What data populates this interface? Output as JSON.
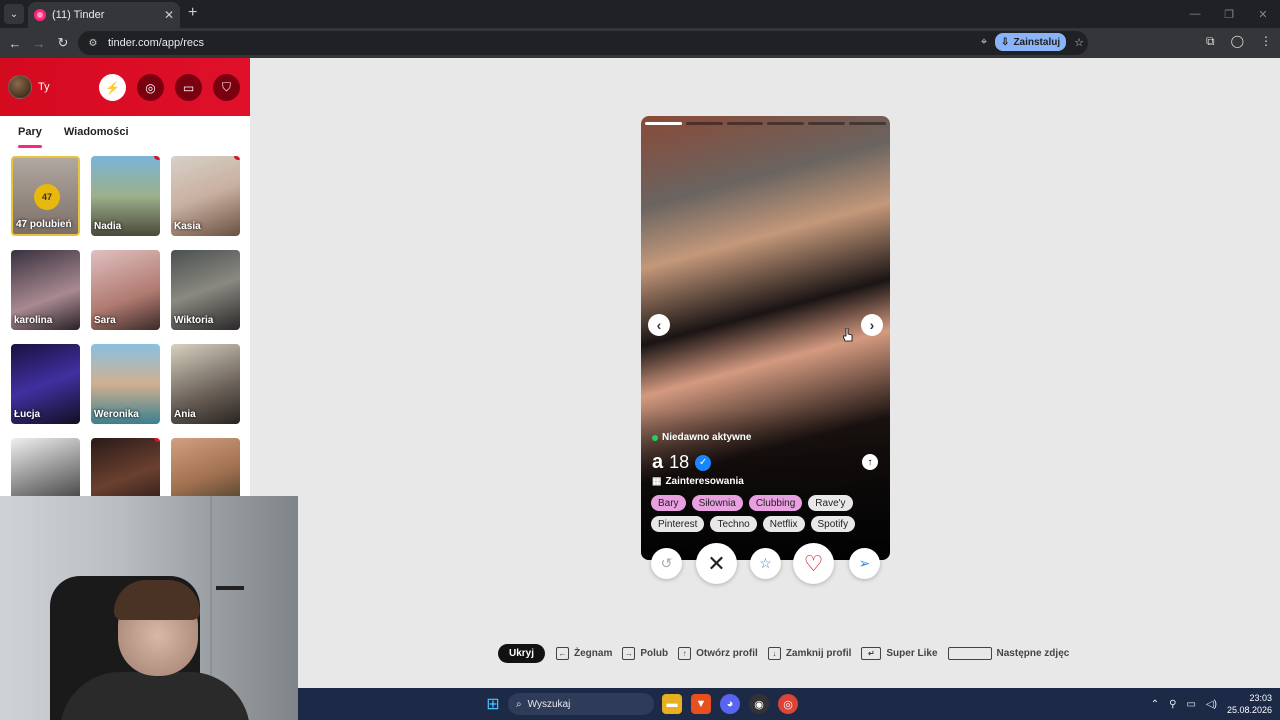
{
  "browser": {
    "tab_title": "(11) Tinder",
    "url": "tinder.com/app/recs",
    "install_label": "Zainstaluj"
  },
  "sidebar": {
    "user_label": "Ty",
    "tabs": [
      "Pary",
      "Wiadomości"
    ],
    "likes_count": "47",
    "likes_label": "47 polubień",
    "matches": [
      {
        "name": "Nadia",
        "unread": true
      },
      {
        "name": "Kasia",
        "unread": true
      },
      {
        "name": "karolina",
        "unread": false
      },
      {
        "name": "Sara",
        "unread": false
      },
      {
        "name": "Wiktoria",
        "unread": false
      },
      {
        "name": "Łucja",
        "unread": false
      },
      {
        "name": "Weronika",
        "unread": false
      },
      {
        "name": "Ania",
        "unread": false
      },
      {
        "name": "",
        "unread": false
      },
      {
        "name": "",
        "unread": true
      },
      {
        "name": "",
        "unread": false
      }
    ]
  },
  "card": {
    "status": "Niedawno aktywne",
    "name": "a",
    "age": "18",
    "interests_title": "Zainteresowania",
    "tags": [
      {
        "label": "Bary",
        "shared": true
      },
      {
        "label": "Siłownia",
        "shared": true
      },
      {
        "label": "Clubbing",
        "shared": true
      },
      {
        "label": "Rave'y",
        "shared": false
      },
      {
        "label": "Pinterest",
        "shared": false
      },
      {
        "label": "Techno",
        "shared": false
      },
      {
        "label": "Netflix",
        "shared": false
      },
      {
        "label": "Spotify",
        "shared": false
      }
    ],
    "photo_count": 6,
    "current_photo": 1
  },
  "hints": {
    "hide": "Ukryj",
    "nope": "Żegnam",
    "like": "Polub",
    "open_profile": "Otwórz profil",
    "close_profile": "Zamknij profil",
    "super_like": "Super Like",
    "next_photo": "Następne zdjęc"
  },
  "taskbar": {
    "search_placeholder": "Wyszukaj",
    "time": "23:03",
    "date": "25.08.2026"
  },
  "colors": {
    "brand_red": "#d0021b",
    "tinder_pink": "#fd267d",
    "shared_tag": "#e8a0e0",
    "taskbar": "#1c2a48"
  }
}
